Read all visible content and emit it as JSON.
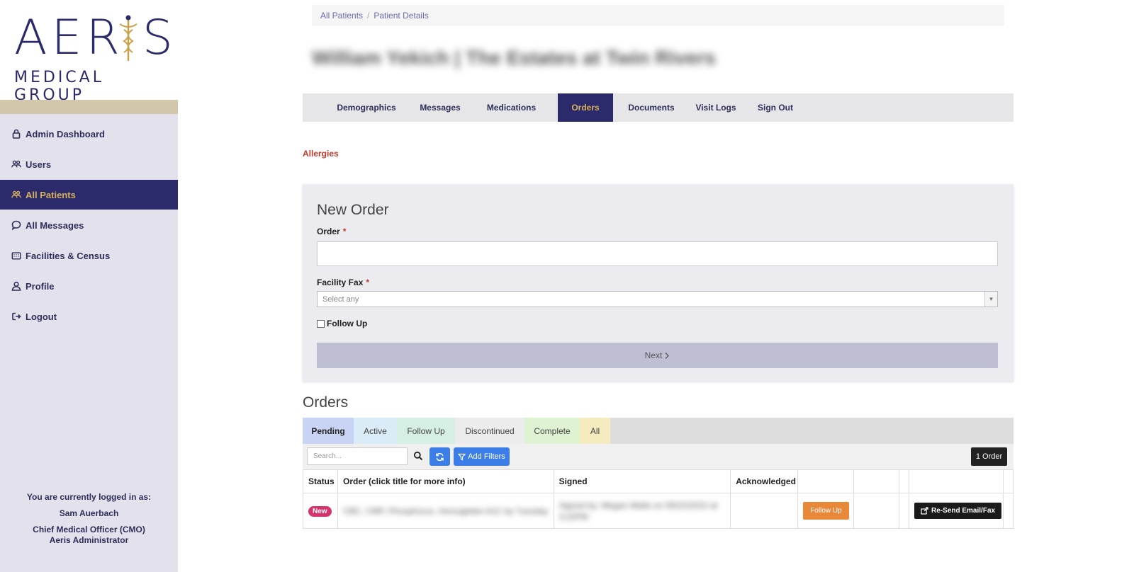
{
  "logo": {
    "brand": "AERIS",
    "subtitle": "MEDICAL GROUP"
  },
  "sidebar": {
    "items": [
      {
        "label": "Admin Dashboard",
        "icon": "lock-icon"
      },
      {
        "label": "Users",
        "icon": "users-icon"
      },
      {
        "label": "All Patients",
        "icon": "users-icon",
        "active": true
      },
      {
        "label": "All Messages",
        "icon": "chat-icon"
      },
      {
        "label": "Facilities & Census",
        "icon": "building-icon"
      },
      {
        "label": "Profile",
        "icon": "user-icon"
      },
      {
        "label": "Logout",
        "icon": "logout-icon"
      }
    ],
    "logged_in": {
      "caption": "You are currently logged in as:",
      "name": "Sam Auerbach",
      "role": "Chief Medical Officer (CMO)",
      "org": "Aeris Administrator"
    }
  },
  "breadcrumb": {
    "items": [
      "All Patients",
      "Patient Details"
    ],
    "separator": "/"
  },
  "patient": {
    "title": "William Yekich | The Estates at Twin Rivers"
  },
  "tabs": [
    "Demographics",
    "Messages",
    "Medications",
    "Orders",
    "Documents",
    "Visit Logs",
    "Sign Out"
  ],
  "active_tab": "Orders",
  "allergies_label": "Allergies",
  "new_order": {
    "heading": "New Order",
    "order_label": "Order",
    "required_mark": "*",
    "facility_fax_label": "Facility Fax",
    "facility_fax_placeholder": "Select any",
    "follow_up_label": "Follow Up",
    "next_label": "Next"
  },
  "orders": {
    "heading": "Orders",
    "tabs": [
      "Pending",
      "Active",
      "Follow Up",
      "Discontinued",
      "Complete",
      "All"
    ],
    "active_tab": "Pending",
    "search_placeholder": "Search...",
    "add_filters_label": "Add Filters",
    "count_label": "1 Order",
    "columns": [
      "Status",
      "Order (click title for more info)",
      "Signed",
      "Acknowledged",
      "",
      "",
      "",
      ""
    ],
    "rows": [
      {
        "status": "New",
        "order": "CBC, CMP, Phosphorus, Hemoglobin A1C by Tuesday",
        "signed": "Signed by: Megan Watts on 09/22/2022 at 3:22PM",
        "acknowledged": "",
        "follow_up_label": "Follow Up",
        "resend_label": "Re-Send Email/Fax"
      }
    ]
  },
  "colors": {
    "brand_navy": "#2b2a6b",
    "brand_gold": "#d7b05b",
    "allergy_red": "#c0392b",
    "action_blue": "#3c7ee8",
    "follow_up_orange": "#e8893a",
    "tab_pending": "#c9d4f5",
    "tab_active": "#d9ecf7",
    "tab_follow_up": "#d6efe4",
    "tab_discontinued": "#ececec",
    "tab_complete": "#dff3d2",
    "tab_all": "#f4ecbf"
  }
}
